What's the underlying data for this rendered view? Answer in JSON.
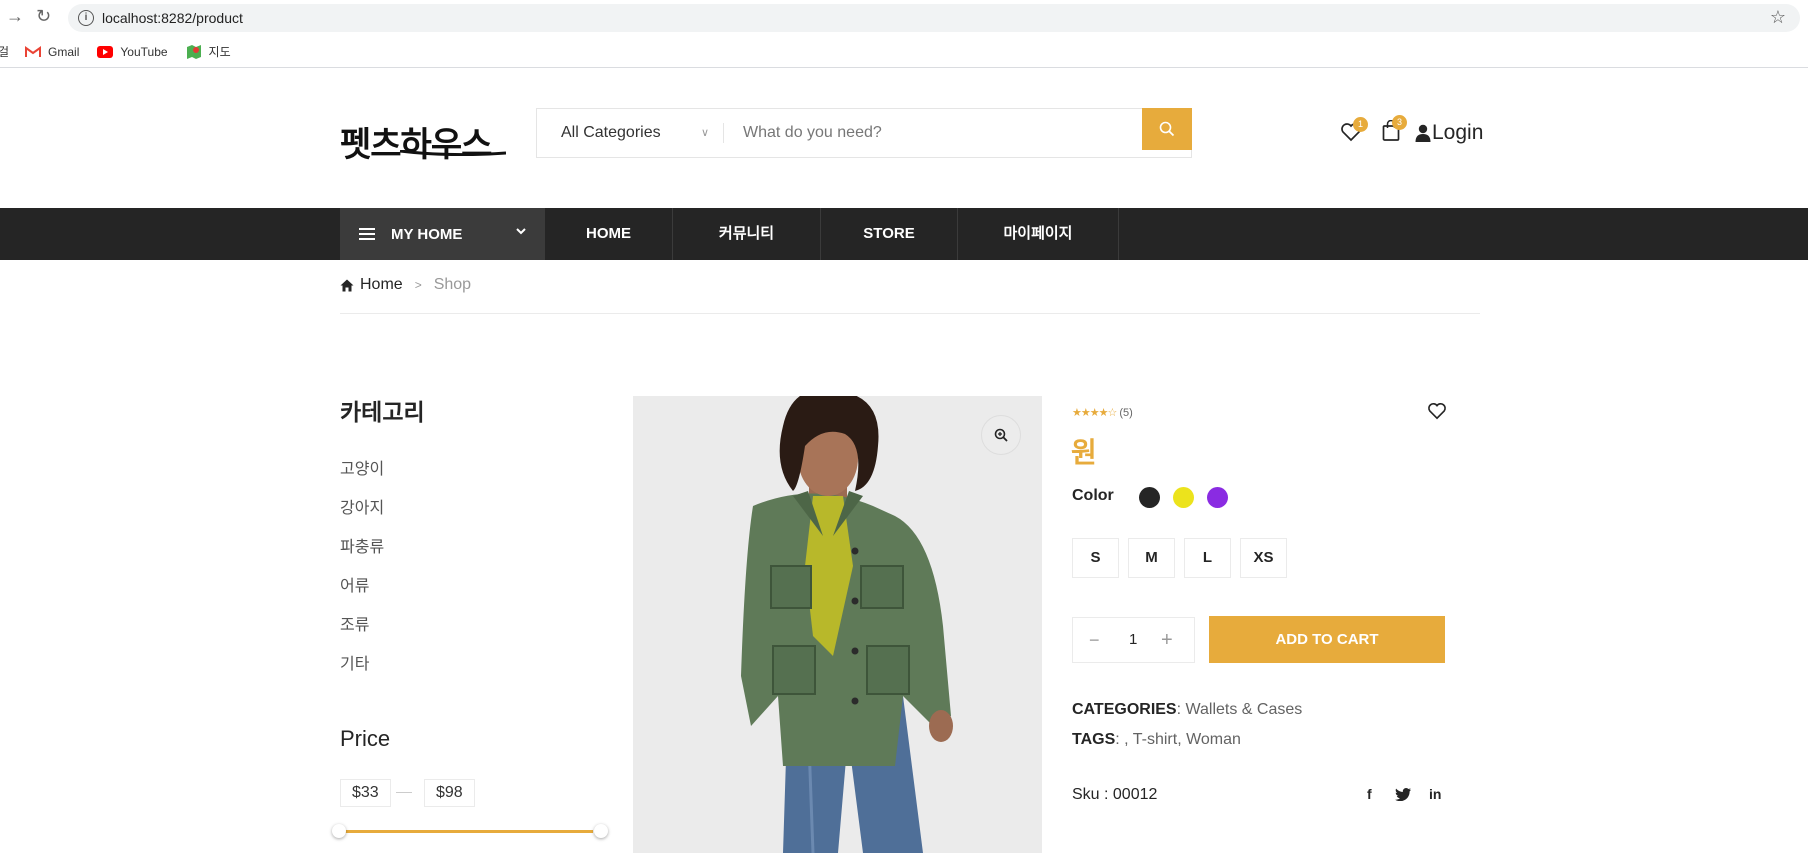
{
  "browser": {
    "url": "localhost:8282/product",
    "bookmarks": [
      {
        "label": "Gmail",
        "icon": "gmail-icon"
      },
      {
        "label": "YouTube",
        "icon": "youtube-icon"
      },
      {
        "label": "지도",
        "icon": "maps-icon"
      }
    ]
  },
  "header": {
    "logo": "펫츠하우스",
    "category_select": "All Categories",
    "search_placeholder": "What do you need?",
    "wishlist_count": "1",
    "cart_count": "3",
    "login_label": "Login"
  },
  "nav": {
    "my_home": "MY HOME",
    "items": [
      "HOME",
      "커뮤니티",
      "STORE",
      "마이페이지"
    ]
  },
  "breadcrumb": {
    "home": "Home",
    "current": "Shop"
  },
  "sidebar": {
    "category_title": "카테고리",
    "categories": [
      "고양이",
      "강아지",
      "파충류",
      "어류",
      "조류",
      "기타"
    ],
    "price_title": "Price",
    "price_min": "$33",
    "price_max": "$98",
    "price_range": [
      33,
      98
    ]
  },
  "product": {
    "rating": 4,
    "rating_count": "(5)",
    "name": "원",
    "color_label": "Color",
    "colors": [
      "#252525",
      "#ece31c",
      "#8a2be2"
    ],
    "sizes": [
      "S",
      "M",
      "L",
      "XS"
    ],
    "quantity": "1",
    "add_to_cart": "ADD TO CART",
    "categories_label": "CATEGORIES",
    "categories_value": ": Wallets & Cases",
    "tags_label": "TAGS",
    "tags_value": ": , T-shirt, Woman",
    "sku": "Sku : 00012"
  },
  "colors": {
    "accent": "#e7ab3c",
    "nav_bg": "#252525"
  }
}
